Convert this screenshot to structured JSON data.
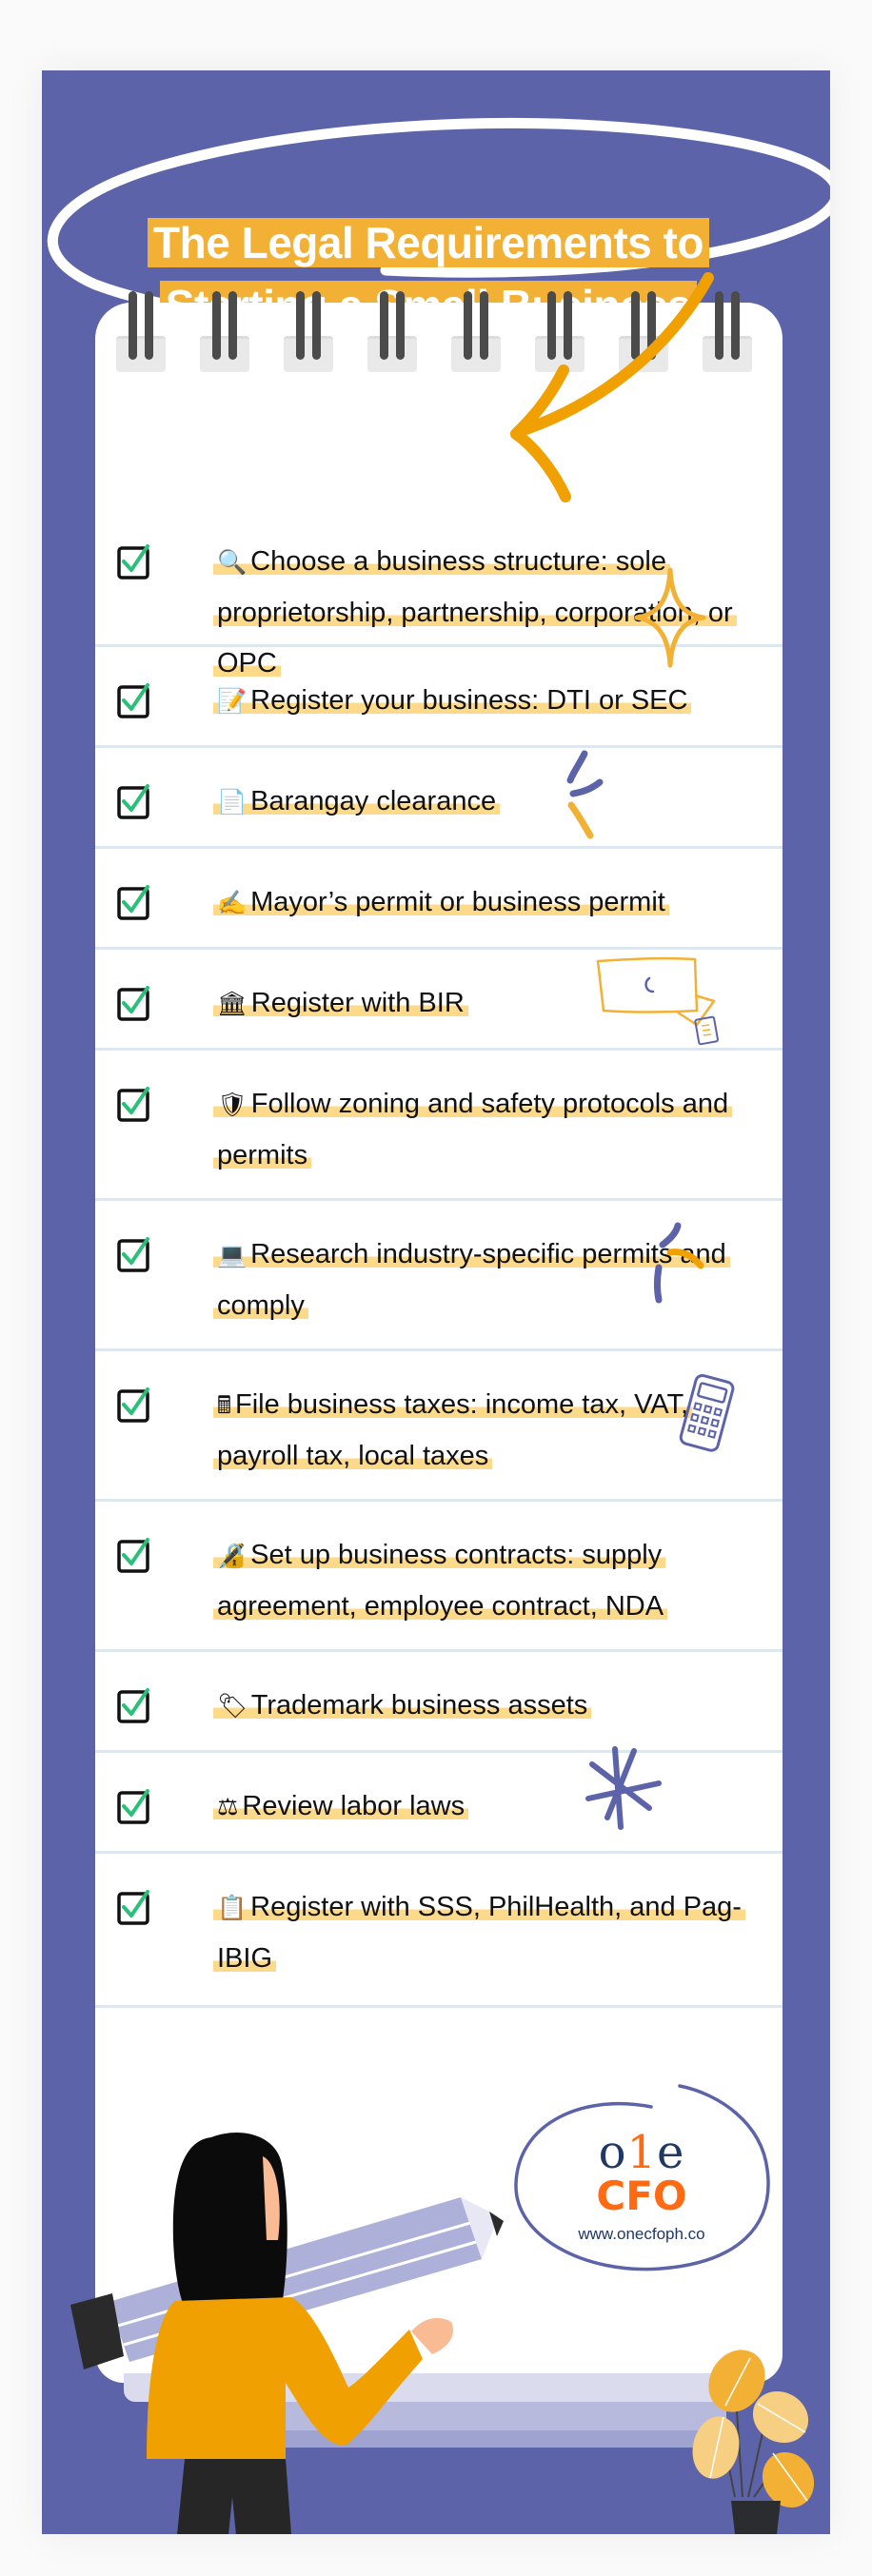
{
  "title": {
    "line1": "The Legal Requirements to",
    "line2": "Starting a Small Business"
  },
  "colors": {
    "panel": "#5c63a9",
    "accent_orange": "#f2b035",
    "highlight": "#fdd98a",
    "check_green": "#2bbf7a",
    "divider": "#d9e8f7"
  },
  "checklist": [
    {
      "icon": "magnifying-glass",
      "emoji": "🔍",
      "text": "Choose a business structure: sole proprietorship, partnership, corporation, or OPC",
      "checked": true
    },
    {
      "icon": "memo",
      "emoji": "📝",
      "text": "Register your business: DTI or SEC",
      "checked": true
    },
    {
      "icon": "document",
      "emoji": "📄",
      "text": "Barangay clearance",
      "checked": true
    },
    {
      "icon": "writing-hand",
      "emoji": "✍",
      "text": "Mayor’s permit or business permit",
      "checked": true
    },
    {
      "icon": "classical-building",
      "emoji": "🏛",
      "text": "Register with BIR",
      "checked": true
    },
    {
      "icon": "shield",
      "emoji": "🛡",
      "text": "Follow zoning and safety protocols and permits",
      "checked": true
    },
    {
      "icon": "laptop",
      "emoji": "💻",
      "text": "Research industry-specific permits and comply",
      "checked": true
    },
    {
      "icon": "calculator",
      "emoji": "🖩",
      "text": "File business taxes: income tax, VAT, payroll tax, local taxes",
      "checked": true
    },
    {
      "icon": "locked-with-pen",
      "emoji": "🔏",
      "text": "Set up business contracts: supply agreement, employee contract, NDA",
      "checked": true
    },
    {
      "icon": "label-tag",
      "emoji": "🏷",
      "text": "Trademark business assets",
      "checked": true
    },
    {
      "icon": "balance-scale",
      "emoji": "⚖",
      "text": "Review labor laws",
      "checked": true
    },
    {
      "icon": "clipboard",
      "emoji": "📋",
      "text": "Register with SSS, PhilHealth, and Pag-IBIG",
      "checked": true
    }
  ],
  "logo": {
    "one_prefix": "o",
    "one_mid": "1",
    "one_suffix": "e",
    "cfo": "CFO",
    "url": "www.onecfoph.co"
  }
}
